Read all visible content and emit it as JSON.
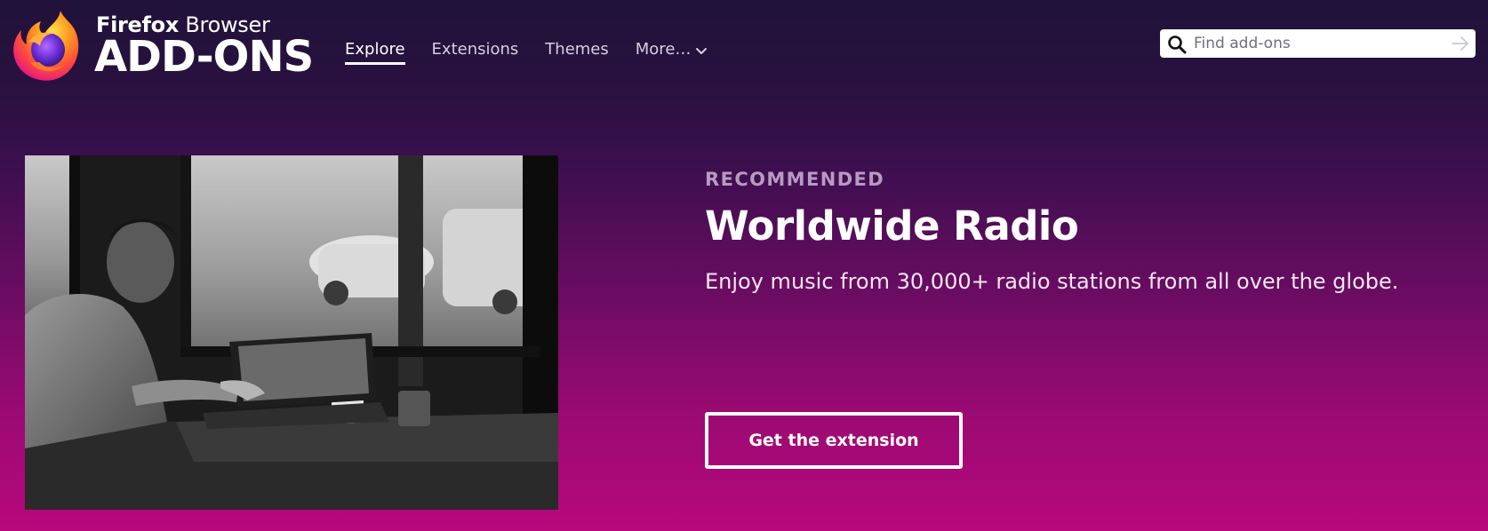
{
  "header": {
    "logo": {
      "small_text_bold": "Firefox",
      "small_text_light": " Browser",
      "big_text": "ADD-ONS"
    },
    "nav": [
      {
        "label": "Explore",
        "active": true
      },
      {
        "label": "Extensions",
        "active": false
      },
      {
        "label": "Themes",
        "active": false
      },
      {
        "label": "More…",
        "active": false,
        "has_dropdown": true
      }
    ],
    "search": {
      "placeholder": "Find add-ons",
      "value": "",
      "icon": "search-icon",
      "submit_icon": "arrow-right-icon"
    }
  },
  "hero": {
    "image_alt": "Worldwide Radio promotional photo",
    "eyebrow": "RECOMMENDED",
    "title": "Worldwide Radio",
    "description": "Enjoy music from 30,000+ radio stations from all over the globe.",
    "cta_label": "Get the extension"
  },
  "colors": {
    "background_top": "#20123a",
    "background_bottom": "#b8087c",
    "eyebrow": "#b89ac2",
    "text": "#ffffff"
  }
}
